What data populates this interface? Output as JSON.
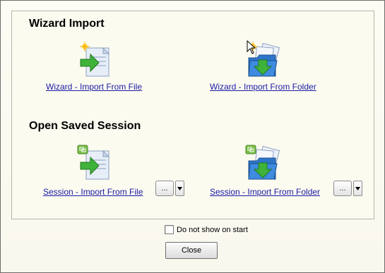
{
  "wizard_section": {
    "title": "Wizard Import",
    "file_link": "Wizard - Import From File",
    "folder_link": "Wizard - Import From Folder"
  },
  "session_section": {
    "title": "Open Saved Session",
    "file_link": "Session - Import From File",
    "folder_link": "Session - Import From Folder",
    "browse_label": "..."
  },
  "footer": {
    "checkbox_label": "Do not show on start",
    "checkbox_checked": false,
    "close_label": "Close"
  },
  "colors": {
    "link": "#1a1aa6",
    "arrow_green": "#3fb23a",
    "folder_blue": "#2d76c9"
  },
  "icons": [
    "wizard-import-file-icon",
    "wizard-import-folder-icon",
    "session-import-file-icon",
    "session-import-folder-icon",
    "mouse-cursor-icon",
    "dropdown-arrow-icon"
  ]
}
